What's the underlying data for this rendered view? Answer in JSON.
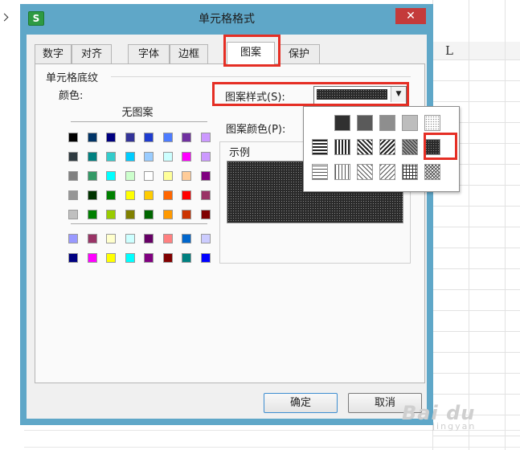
{
  "window": {
    "title": "单元格格式",
    "app_icon": "S",
    "close_icon": "✕"
  },
  "spreadsheet": {
    "column_label": "L"
  },
  "tabs": [
    {
      "label": "数字"
    },
    {
      "label": "对齐"
    },
    {
      "label": "字体"
    },
    {
      "label": "边框"
    },
    {
      "label": "图案",
      "active": true
    },
    {
      "label": "保护"
    }
  ],
  "shading": {
    "group_title": "单元格底纹",
    "color_label": "颜色:",
    "no_pattern_label": "无图案",
    "palette": [
      [
        "#000000",
        "#003366",
        "#000080",
        "#333399",
        "#1f3ccf",
        "#4d7cff",
        "#7030a0",
        "#cc99ff"
      ],
      [
        "#2f3a40",
        "#008080",
        "#33cccc",
        "#00ccff",
        "#99ccff",
        "#ccffff",
        "#ff00ff",
        "#cc99ff"
      ],
      [
        "#808080",
        "#339966",
        "#00ffff",
        "#ccffcc",
        "#ffffff",
        "#ffff99",
        "#ffcc99",
        "#800080"
      ],
      [
        "#969696",
        "#003300",
        "#008000",
        "#ffff00",
        "#ffcc00",
        "#ff6600",
        "#ff0000",
        "#993366"
      ],
      [
        "#c0c0c0",
        "#008000",
        "#99cc00",
        "#808000",
        "#006600",
        "#ff9900",
        "#cc3300",
        "#800000"
      ]
    ],
    "palette_extra": [
      [
        "#9999ff",
        "#993366",
        "#ffffcc",
        "#ccffff",
        "#660066",
        "#ff8080",
        "#0066cc",
        "#ccccff"
      ],
      [
        "#000080",
        "#ff00ff",
        "#ffff00",
        "#00ffff",
        "#800080",
        "#800000",
        "#008080",
        "#0000ff"
      ]
    ]
  },
  "pattern": {
    "style_label": "图案样式(S):",
    "color_label": "图案颜色(P):",
    "sample_label": "示例",
    "selected_style": "dense-dot"
  },
  "dropdown": {
    "options": [
      "solid",
      "dark-gray",
      "medium-gray",
      "light-gray",
      "gray-12",
      "horizontal-thick",
      "vertical-thick",
      "diagonal-down-thick",
      "diagonal-up-thick",
      "grid-thick",
      "dense-dot",
      "horizontal-thin",
      "vertical-thin",
      "diagonal-down-thin",
      "diagonal-up-thin",
      "grid-thin",
      "crosshatch-thin"
    ]
  },
  "buttons": {
    "ok": "确定",
    "cancel": "取消"
  },
  "watermark": {
    "logo": "Bai du",
    "sub": "jingyan"
  },
  "colors": {
    "highlight": "#e52e24",
    "dialog_frame": "#5fa7c8",
    "close_button": "#c43b3b"
  }
}
